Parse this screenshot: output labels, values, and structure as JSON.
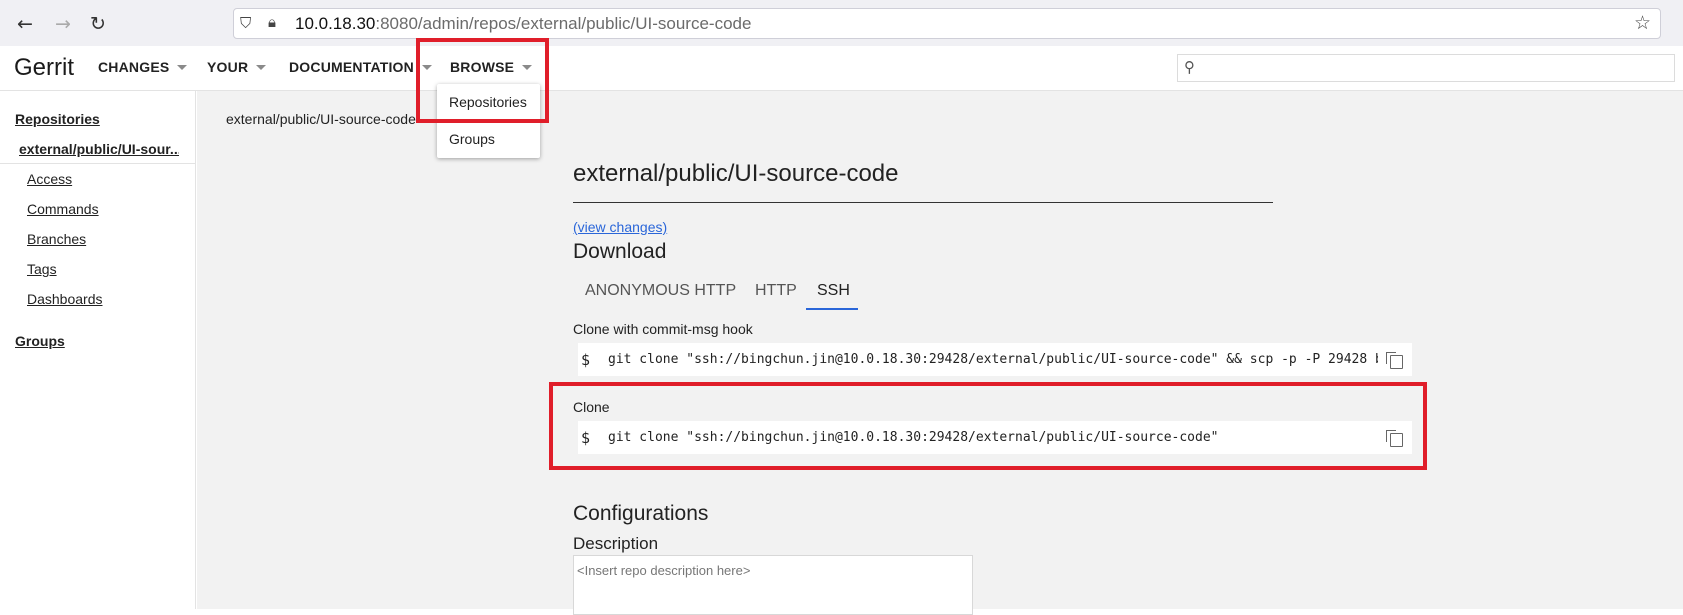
{
  "browser": {
    "url_host": "10.0.18.30",
    "url_path": ":8080/admin/repos/external/public/UI-source-code"
  },
  "header": {
    "logo": "Gerrit",
    "nav": [
      "CHANGES",
      "YOUR",
      "DOCUMENTATION",
      "BROWSE"
    ],
    "browse_menu": [
      "Repositories",
      "Groups"
    ]
  },
  "sidebar": {
    "repositories_label": "Repositories",
    "repo_name": "external/public/UI-sour...",
    "items": [
      "Access",
      "Commands",
      "Branches",
      "Tags",
      "Dashboards"
    ],
    "groups_label": "Groups"
  },
  "main": {
    "breadcrumb": "external/public/UI-source-code",
    "title": "external/public/UI-source-code",
    "view_changes": "(view changes)",
    "download_heading": "Download",
    "tabs": [
      "ANONYMOUS HTTP",
      "HTTP",
      "SSH"
    ],
    "active_tab": "SSH",
    "clone_hook_label": "Clone with commit-msg hook",
    "clone_hook_cmd": "git clone \"ssh://bingchun.jin@10.0.18.30:29428/external/public/UI-source-code\" && scp -p -P 29428 b",
    "clone_label": "Clone",
    "clone_cmd": "git clone \"ssh://bingchun.jin@10.0.18.30:29428/external/public/UI-source-code\"",
    "prompt": "$",
    "configurations_heading": "Configurations",
    "description_label": "Description",
    "description_placeholder": "<Insert repo description here>"
  },
  "colors": {
    "annotation_red": "#e01e2a",
    "link_blue": "#2a66d9",
    "main_bg": "#f2f2f2"
  }
}
